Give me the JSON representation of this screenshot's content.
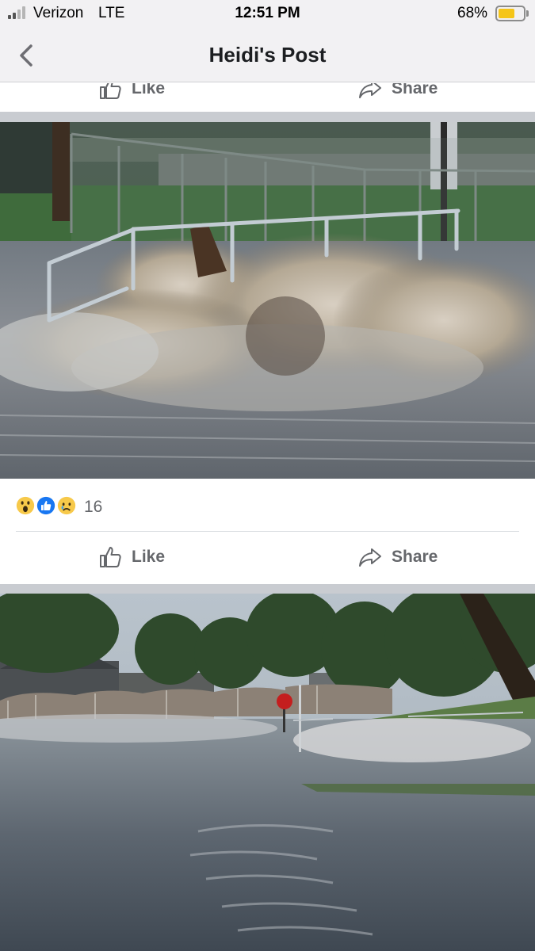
{
  "status_bar": {
    "carrier": "Verizon",
    "network": "LTE",
    "time": "12:51 PM",
    "battery_percent": "68%",
    "battery_level": 0.68,
    "signal_bars_filled": 2,
    "signal_bars_total": 4
  },
  "nav": {
    "title": "Heidi's Post",
    "back_icon": "chevron-left-icon"
  },
  "top_actions": {
    "like_label": "Like",
    "share_label": "Share"
  },
  "photo_1": {
    "description_icon": "photo"
  },
  "reactions": {
    "icons": [
      "wow-reaction-icon",
      "like-reaction-icon",
      "sad-reaction-icon"
    ],
    "count": "16"
  },
  "actions": {
    "like_label": "Like",
    "share_label": "Share"
  },
  "colors": {
    "bar_background": "#f2f1f3",
    "action_text": "#65676b",
    "like_blue": "#1877f2",
    "battery_yellow": "#f5c518"
  }
}
